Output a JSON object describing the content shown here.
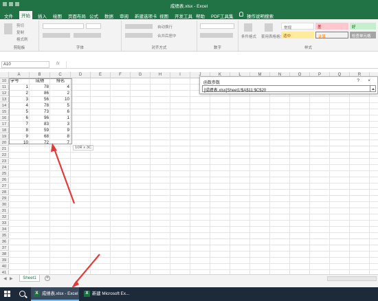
{
  "app": {
    "window_title": "成绩表.xlsx - Excel"
  },
  "ribbon": {
    "tabs": [
      "文件",
      "开始",
      "插入",
      "绘图",
      "页面布局",
      "公式",
      "数据",
      "审阅",
      "新建选项卡",
      "视图",
      "开发工具",
      "帮助",
      "PDF工具集",
      "操作说明搜索"
    ],
    "active_tab": "开始",
    "groups": [
      "剪贴板",
      "字体",
      "对齐方式",
      "数字",
      "样式"
    ],
    "clipboard_buttons": [
      "剪切",
      "复制",
      "格式刷"
    ],
    "align_buttons": [
      "自动换行",
      "合并后居中"
    ],
    "number_format": "常规",
    "style_buttons": [
      "条件格式",
      "套用表格格式"
    ],
    "styles": [
      "常规",
      "差",
      "适中",
      "计算",
      "好",
      "检查单元格"
    ]
  },
  "formula_bar": {
    "name_box": "A10",
    "fx_label": "fx",
    "formula": ""
  },
  "sheet": {
    "columns": [
      "A",
      "B",
      "C",
      "D",
      "E",
      "F",
      "G",
      "H",
      "I",
      "J",
      "K",
      "L",
      "M",
      "N",
      "O",
      "P",
      "Q",
      "R",
      "S"
    ],
    "header_row": {
      "row": "10",
      "a": "学号",
      "b": "成绩",
      "c": "排名"
    },
    "rows": [
      {
        "row": "11",
        "a": "1",
        "b": "78",
        "c": "4"
      },
      {
        "row": "12",
        "a": "2",
        "b": "86",
        "c": "2"
      },
      {
        "row": "13",
        "a": "3",
        "b": "56",
        "c": "10"
      },
      {
        "row": "14",
        "a": "4",
        "b": "78",
        "c": "5"
      },
      {
        "row": "15",
        "a": "5",
        "b": "73",
        "c": "6"
      },
      {
        "row": "16",
        "a": "6",
        "b": "96",
        "c": "1"
      },
      {
        "row": "17",
        "a": "7",
        "b": "83",
        "c": "3"
      },
      {
        "row": "18",
        "a": "8",
        "b": "59",
        "c": "9"
      },
      {
        "row": "19",
        "a": "9",
        "b": "68",
        "c": "8"
      },
      {
        "row": "20",
        "a": "10",
        "b": "72",
        "c": "7"
      }
    ],
    "empty_rows": [
      "21",
      "22",
      "23",
      "24",
      "25",
      "26",
      "27",
      "28",
      "29",
      "30",
      "31",
      "32",
      "33",
      "34",
      "35",
      "36",
      "37",
      "38",
      "39",
      "40",
      "41",
      "42",
      "43"
    ],
    "selection_tip": "10R x 3C"
  },
  "dialog": {
    "title": "函数参数",
    "help": "?",
    "close": "×",
    "input_value": "[成绩表.xlsx]Sheet1!$A$11:$C$20"
  },
  "sheet_tabs": {
    "active": "Sheet1",
    "add_label": "+"
  },
  "taskbar": {
    "apps": [
      {
        "label": "成绩表.xlsx - Excel",
        "active": true
      },
      {
        "label": "新建 Microsoft Ex...",
        "active": false
      }
    ],
    "excel_icon": "X"
  },
  "colors": {
    "excel_green": "#217346",
    "taskbar": "#1c2a3a",
    "arrow": "#e53935"
  }
}
